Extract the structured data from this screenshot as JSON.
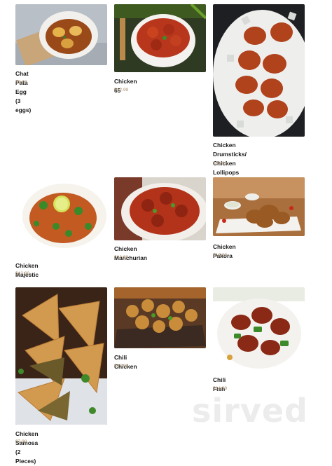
{
  "menu_items": [
    {
      "name": "Chat Pata Egg (3 eggs)",
      "price": "$9.99"
    },
    {
      "name": "Chicken 65",
      "price": "$12.99"
    },
    {
      "name": "Chicken Drumsticks/ Chicken Lollipops",
      "name_line1": "Chicken Drumsticks/ Chicken",
      "name_line2": "Lollipops",
      "price": "$14.99"
    },
    {
      "name": "Chicken Majestic",
      "price": "$12.99"
    },
    {
      "name": "Chicken Manchurian",
      "price": "$12.99"
    },
    {
      "name": "Chicken Pakora",
      "price": "$12.99"
    },
    {
      "name": "Chicken Samosa (2 Pieces)",
      "price": "$7.99"
    },
    {
      "name": "Chili Chicken",
      "price": "$12.99"
    },
    {
      "name": "Chili Fish",
      "price": "$14.99"
    }
  ],
  "watermark": "sirved",
  "colors": {
    "price": "#a98f6e",
    "name": "#1a1a1a"
  }
}
